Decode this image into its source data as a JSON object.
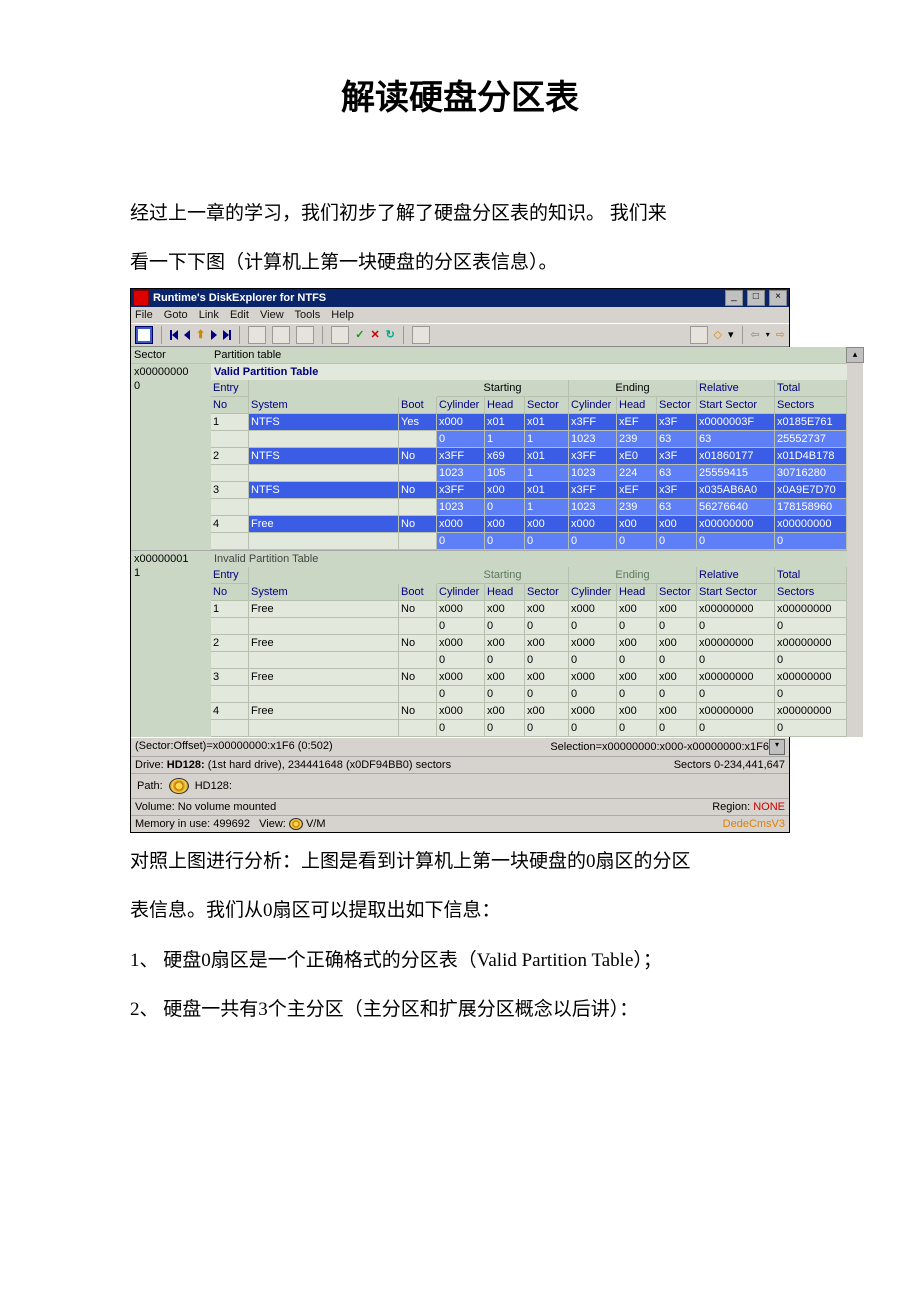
{
  "document": {
    "title": "解读硬盘分区表",
    "p1": "经过上一章的学习，我们初步了解了硬盘分区表的知识。 我们来",
    "p2": "看一下下图（计算机上第一块硬盘的分区表信息）。",
    "p3": "对照上图进行分析：上图是看到计算机上第一块硬盘的0扇区的分区",
    "p4": "表信息。我们从0扇区可以提取出如下信息：",
    "p5": "1、 硬盘0扇区是一个正确格式的分区表（Valid Partition Table）；",
    "p6": "2、 硬盘一共有3个主分区（主分区和扩展分区概念以后讲）："
  },
  "app": {
    "title": "Runtime's DiskExplorer for NTFS",
    "menu": [
      "File",
      "Goto",
      "Link",
      "Edit",
      "View",
      "Tools",
      "Help"
    ],
    "header": {
      "sector": "Sector",
      "partition": "Partition table"
    },
    "rows": {
      "r1": {
        "sector": "x00000000",
        "label": "Valid Partition Table"
      },
      "r1b": {
        "sector": "0"
      },
      "col_headers": {
        "entryno": "Entry No",
        "system": "System",
        "boot": "Boot",
        "starting": "Starting",
        "ending": "Ending",
        "cyl": "Cylinder",
        "head": "Head",
        "sector": "Sector",
        "relative": "Relative Start Sector",
        "total": "Total Sectors"
      }
    },
    "table1": [
      {
        "no": "1",
        "sys": "NTFS",
        "boot": "Yes",
        "sc": "x000",
        "sh": "x01",
        "ss": "x01",
        "ec": "x3FF",
        "eh": "xEF",
        "es": "x3F",
        "rel": "x0000003F",
        "tot": "x0185E761",
        "sc2": "0",
        "sh2": "1",
        "ss2": "1",
        "ec2": "1023",
        "eh2": "239",
        "es2": "63",
        "rel2": "63",
        "tot2": "25552737"
      },
      {
        "no": "2",
        "sys": "NTFS",
        "boot": "No",
        "sc": "x3FF",
        "sh": "x69",
        "ss": "x01",
        "ec": "x3FF",
        "eh": "xE0",
        "es": "x3F",
        "rel": "x01860177",
        "tot": "x01D4B178",
        "sc2": "1023",
        "sh2": "105",
        "ss2": "1",
        "ec2": "1023",
        "eh2": "224",
        "es2": "63",
        "rel2": "25559415",
        "tot2": "30716280"
      },
      {
        "no": "3",
        "sys": "NTFS",
        "boot": "No",
        "sc": "x3FF",
        "sh": "x00",
        "ss": "x01",
        "ec": "x3FF",
        "eh": "xEF",
        "es": "x3F",
        "rel": "x035AB6A0",
        "tot": "x0A9E7D70",
        "sc2": "1023",
        "sh2": "0",
        "ss2": "1",
        "ec2": "1023",
        "eh2": "239",
        "es2": "63",
        "rel2": "56276640",
        "tot2": "178158960"
      },
      {
        "no": "4",
        "sys": "Free",
        "boot": "No",
        "sc": "x000",
        "sh": "x00",
        "ss": "x00",
        "ec": "x000",
        "eh": "x00",
        "es": "x00",
        "rel": "x00000000",
        "tot": "x00000000",
        "sc2": "0",
        "sh2": "0",
        "ss2": "0",
        "ec2": "0",
        "eh2": "0",
        "es2": "0",
        "rel2": "0",
        "tot2": "0"
      }
    ],
    "r2": {
      "sector": "x00000001",
      "label": "Invalid Partition Table",
      "sector2": "1"
    },
    "table2": [
      {
        "no": "1",
        "sys": "Free",
        "boot": "No",
        "sc": "x000",
        "sh": "x00",
        "ss": "x00",
        "ec": "x000",
        "eh": "x00",
        "es": "x00",
        "rel": "x00000000",
        "tot": "x00000000",
        "sc2": "0",
        "sh2": "0",
        "ss2": "0",
        "ec2": "0",
        "eh2": "0",
        "es2": "0",
        "rel2": "0",
        "tot2": "0"
      },
      {
        "no": "2",
        "sys": "Free",
        "boot": "No",
        "sc": "x000",
        "sh": "x00",
        "ss": "x00",
        "ec": "x000",
        "eh": "x00",
        "es": "x00",
        "rel": "x00000000",
        "tot": "x00000000",
        "sc2": "0",
        "sh2": "0",
        "ss2": "0",
        "ec2": "0",
        "eh2": "0",
        "es2": "0",
        "rel2": "0",
        "tot2": "0"
      },
      {
        "no": "3",
        "sys": "Free",
        "boot": "No",
        "sc": "x000",
        "sh": "x00",
        "ss": "x00",
        "ec": "x000",
        "eh": "x00",
        "es": "x00",
        "rel": "x00000000",
        "tot": "x00000000",
        "sc2": "0",
        "sh2": "0",
        "ss2": "0",
        "ec2": "0",
        "eh2": "0",
        "es2": "0",
        "rel2": "0",
        "tot2": "0"
      },
      {
        "no": "4",
        "sys": "Free",
        "boot": "No",
        "sc": "x000",
        "sh": "x00",
        "ss": "x00",
        "ec": "x000",
        "eh": "x00",
        "es": "x00",
        "rel": "x00000000",
        "tot": "x00000000",
        "sc2": "0",
        "sh2": "0",
        "ss2": "0",
        "ec2": "0",
        "eh2": "0",
        "es2": "0",
        "rel2": "0",
        "tot2": "0"
      }
    ],
    "status": {
      "left": "(Sector:Offset)=x00000000:x1F6 (0:502)",
      "right": "Selection=x00000000:x000-x00000000:x1F6"
    },
    "drive": {
      "left_lbl": "Drive: ",
      "left_b": "HD128:",
      "left_rest": " (1st hard drive), 234441648 (x0DF94BB0) sectors",
      "right": "Sectors 0-234,441,647"
    },
    "path": {
      "lbl": "Path:",
      "val": "HD128:"
    },
    "volume": {
      "left": "Volume:  No volume mounted",
      "right": "Region: NONE"
    },
    "memory": {
      "left": "Memory in use: 499692",
      "view_lbl": "View:",
      "view_val": "V/M",
      "right": "DedeCmsV3"
    }
  }
}
